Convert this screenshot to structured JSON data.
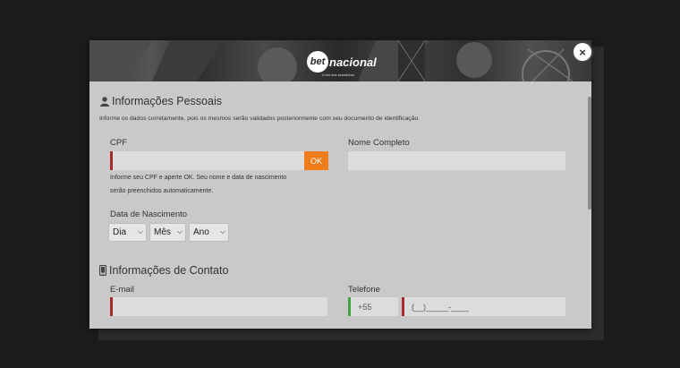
{
  "modal": {
    "brand": {
      "logo_mark": "bet",
      "logo_word": "nacional",
      "tagline": "A bet dos brasileiros"
    },
    "close_label": "×"
  },
  "personal": {
    "title": "Informações Pessoais",
    "intro": "Informe os dados corretamente, pois os mesmos serão validados posteriormente com seu documento de identificação.",
    "cpf_label": "CPF",
    "cpf_value": "",
    "ok_label": "OK",
    "cpf_help_line1": "Informe seu CPF e aperte OK. Seu nome e data de nascimento",
    "cpf_help_line2": "serão preenchidos automaticamente.",
    "name_label": "Nome Completo",
    "name_value": "",
    "birth_label": "Data de Nascimento",
    "day_selected": "Dia",
    "month_selected": "Mês",
    "year_selected": "Ano"
  },
  "contact": {
    "title": "Informações de Contato",
    "email_label": "E-mail",
    "email_value": "",
    "phone_label": "Telefone",
    "phone_prefix": "+55",
    "phone_mask": "(__)_____-____"
  },
  "colors": {
    "accent_orange": "#f07d1a",
    "invalid_red": "#a52a2a",
    "valid_green": "#3fa33f"
  }
}
